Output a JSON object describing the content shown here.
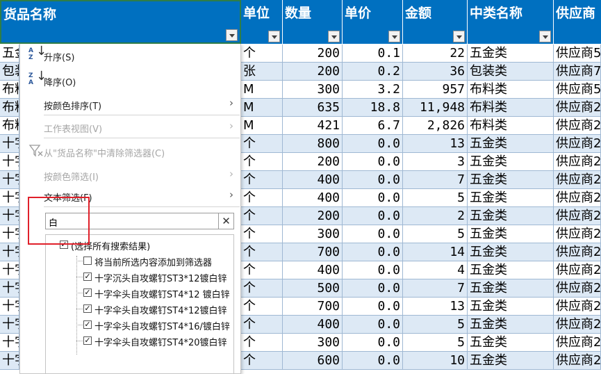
{
  "headers": [
    "货品名称",
    "单位",
    "数量",
    "单价",
    "金额",
    "中类名称",
    "供应商"
  ],
  "rows": [
    {
      "name": "五金",
      "unit": "个",
      "qty": "200",
      "price": "0.1",
      "amount": "22",
      "cat": "五金类",
      "sup": "供应商5"
    },
    {
      "name": "包装",
      "unit": "张",
      "qty": "200",
      "price": "0.2",
      "amount": "36",
      "cat": "包装类",
      "sup": "供应商7"
    },
    {
      "name": "布料",
      "unit": "M",
      "qty": "300",
      "price": "3.2",
      "amount": "957",
      "cat": "布料类",
      "sup": "供应商5"
    },
    {
      "name": "布料",
      "unit": "M",
      "qty": "635",
      "price": "18.8",
      "amount": "11,948",
      "cat": "布料类",
      "sup": "供应商2"
    },
    {
      "name": "布料",
      "unit": "M",
      "qty": "421",
      "price": "6.7",
      "amount": "2,826",
      "cat": "布料类",
      "sup": "供应商2"
    },
    {
      "name": "十字",
      "unit": "个",
      "qty": "800",
      "price": "0.0",
      "amount": "13",
      "cat": "五金类",
      "sup": "供应商2"
    },
    {
      "name": "十字",
      "unit": "个",
      "qty": "200",
      "price": "0.0",
      "amount": "3",
      "cat": "五金类",
      "sup": "供应商2"
    },
    {
      "name": "十字",
      "unit": "个",
      "qty": "400",
      "price": "0.0",
      "amount": "7",
      "cat": "五金类",
      "sup": "供应商2"
    },
    {
      "name": "十字",
      "unit": "个",
      "qty": "400",
      "price": "0.0",
      "amount": "5",
      "cat": "五金类",
      "sup": "供应商2"
    },
    {
      "name": "十字",
      "unit": "个",
      "qty": "200",
      "price": "0.0",
      "amount": "2",
      "cat": "五金类",
      "sup": "供应商2"
    },
    {
      "name": "十字",
      "unit": "个",
      "qty": "300",
      "price": "0.0",
      "amount": "5",
      "cat": "五金类",
      "sup": "供应商2"
    },
    {
      "name": "十字",
      "unit": "个",
      "qty": "700",
      "price": "0.0",
      "amount": "14",
      "cat": "五金类",
      "sup": "供应商2"
    },
    {
      "name": "十字",
      "unit": "个",
      "qty": "400",
      "price": "0.0",
      "amount": "4",
      "cat": "五金类",
      "sup": "供应商2"
    },
    {
      "name": "十字",
      "unit": "个",
      "qty": "500",
      "price": "0.0",
      "amount": "7",
      "cat": "五金类",
      "sup": "供应商2"
    },
    {
      "name": "十字",
      "unit": "个",
      "qty": "700",
      "price": "0.0",
      "amount": "13",
      "cat": "五金类",
      "sup": "供应商2"
    },
    {
      "name": "十字",
      "unit": "个",
      "qty": "400",
      "price": "0.0",
      "amount": "5",
      "cat": "五金类",
      "sup": "供应商2"
    },
    {
      "name": "十字",
      "unit": "个",
      "qty": "300",
      "price": "0.0",
      "amount": "5",
      "cat": "五金类",
      "sup": "供应商2"
    },
    {
      "name": "十字",
      "unit": "个",
      "qty": "600",
      "price": "0.0",
      "amount": "10",
      "cat": "五金类",
      "sup": "供应商2"
    }
  ],
  "menu": {
    "sort_asc": "升序(S)",
    "sort_desc": "降序(O)",
    "sort_by_color": "按颜色排序(T)",
    "sheet_view": "工作表视图(V)",
    "clear_filter": "从\"货品名称\"中清除筛选器(C)",
    "filter_by_color": "按颜色筛选(I)",
    "text_filter": "文本筛选(F)",
    "search_value": "白",
    "clear_glyph": "✕",
    "items": [
      {
        "label": "(选择所有搜索结果)",
        "checked": true
      },
      {
        "label": "将当前所选内容添加到筛选器",
        "checked": false
      },
      {
        "label": "十字沉头自攻螺钉ST3*12镀白锌",
        "checked": true
      },
      {
        "label": "十字伞头自攻螺钉ST4*12  镀白锌",
        "checked": true
      },
      {
        "label": "十字伞头自攻螺钉ST4*12镀白锌",
        "checked": true
      },
      {
        "label": "十字伞头自攻螺钉ST4*16/镀白锌",
        "checked": true
      },
      {
        "label": "十字伞头自攻螺钉ST4*20镀白锌",
        "checked": true
      }
    ]
  },
  "icons": {
    "sort_asc": "sort-ascending-icon",
    "sort_desc": "sort-descending-icon",
    "clear_filter": "filter-clear-icon",
    "dropdown": "dropdown-arrow-icon",
    "submenu": "chevron-right-icon"
  },
  "colors": {
    "header_bg": "#0070c0",
    "band_row": "#dde9f5",
    "highlight_box": "#e0202a"
  }
}
